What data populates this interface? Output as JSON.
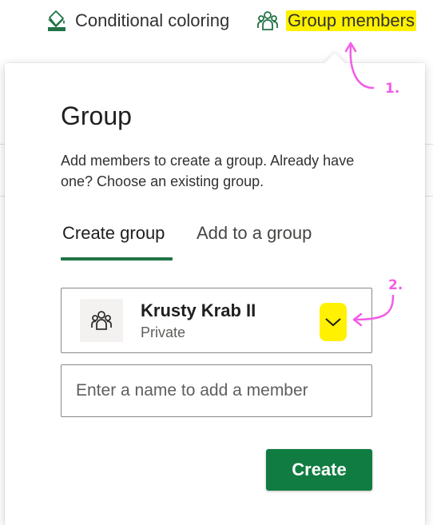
{
  "toolbar": {
    "conditional_label": "Conditional coloring",
    "group_label": "Group members"
  },
  "panel": {
    "title": "Group",
    "description": "Add members to create a group. Already have one? Choose an existing group.",
    "tabs": [
      {
        "label": "Create group",
        "selected": true
      },
      {
        "label": "Add to a group",
        "selected": false
      }
    ],
    "group": {
      "name": "Krusty Krab II",
      "privacy": "Private"
    },
    "member_input": {
      "placeholder": "Enter a name to add a member",
      "value": ""
    },
    "create_label": "Create"
  },
  "annotations": {
    "step1": "1.",
    "step2": "2."
  },
  "colors": {
    "accent": "#217346",
    "button": "#107c41",
    "highlight": "#fff100",
    "annotation": "#f25ce8"
  },
  "icons": {
    "conditional": "paint-bucket-icon",
    "group": "people-group-icon",
    "avatar": "people-group-icon",
    "dropdown": "chevron-down-icon"
  }
}
